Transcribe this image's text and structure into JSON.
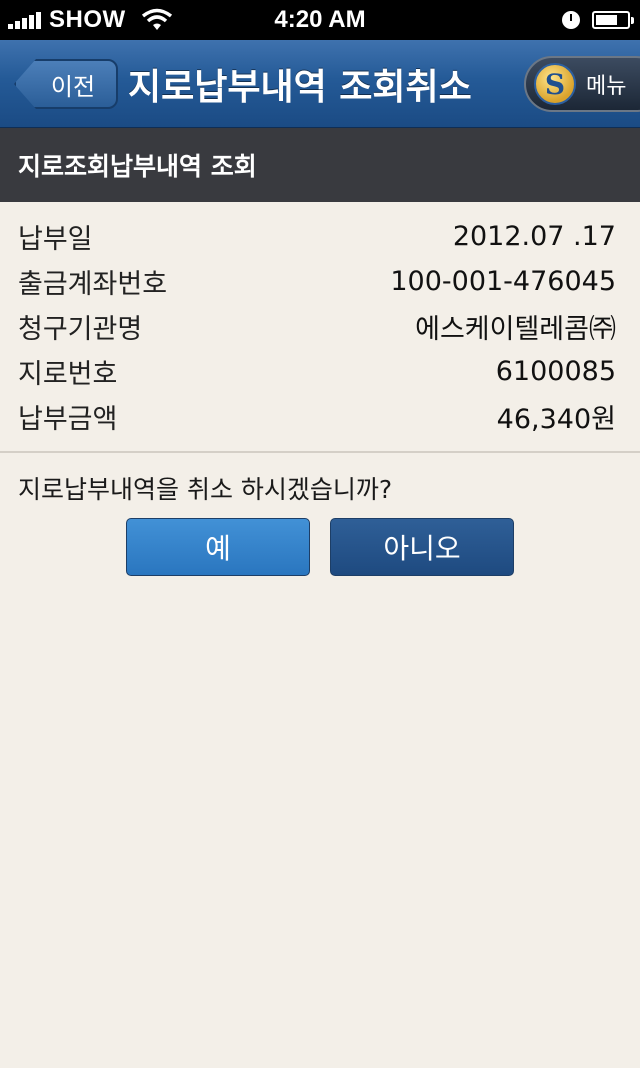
{
  "statusbar": {
    "carrier": "SHOW",
    "time": "4:20 AM"
  },
  "nav": {
    "back_label": "이전",
    "title": "지로납부내역 조회취소",
    "menu_label": "메뉴",
    "logo_glyph": "S"
  },
  "section": {
    "title": "지로조회납부내역 조회"
  },
  "details": {
    "rows": [
      {
        "label": "납부일",
        "value": "2012.07 .17"
      },
      {
        "label": "출금계좌번호",
        "value": "100-001-476045"
      },
      {
        "label": "청구기관명",
        "value": "에스케이텔레콤㈜"
      },
      {
        "label": "지로번호",
        "value": "6100085"
      },
      {
        "label": "납부금액",
        "value": "46,340원"
      }
    ]
  },
  "confirm": {
    "question": "지로납부내역을 취소 하시겠습니까?",
    "yes_label": "예",
    "no_label": "아니오"
  },
  "colors": {
    "nav_blue": "#245a97",
    "section_bg": "#393a3f",
    "page_bg": "#f3efe8",
    "yes_button": "#3484cb",
    "no_button": "#27548b"
  }
}
